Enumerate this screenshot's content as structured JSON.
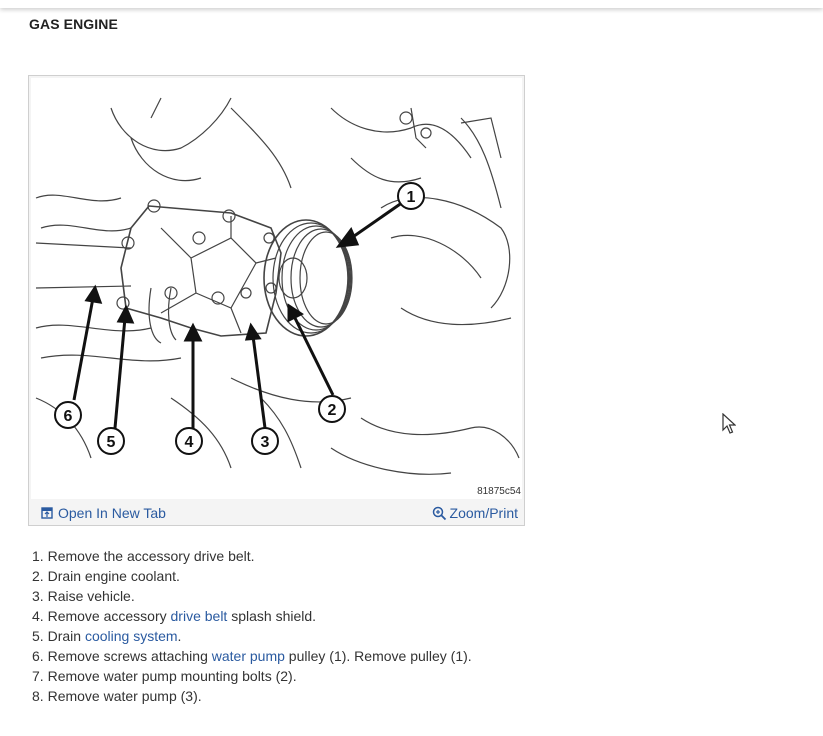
{
  "page": {
    "heading": "GAS ENGINE"
  },
  "figure": {
    "image_id": "81875c54",
    "callouts": [
      "1",
      "2",
      "3",
      "4",
      "5",
      "6"
    ],
    "open_tab_label": "Open In New Tab",
    "zoom_print_label": "Zoom/Print"
  },
  "steps": [
    {
      "num": "1.",
      "pre": "Remove the accessory drive belt.",
      "link": "",
      "post": ""
    },
    {
      "num": "2.",
      "pre": "Drain engine coolant.",
      "link": "",
      "post": ""
    },
    {
      "num": "3.",
      "pre": "Raise vehicle.",
      "link": "",
      "post": ""
    },
    {
      "num": "4.",
      "pre": "Remove accessory ",
      "link": "drive belt",
      "post": " splash shield."
    },
    {
      "num": "5.",
      "pre": "Drain ",
      "link": "cooling system",
      "post": "."
    },
    {
      "num": "6.",
      "pre": "Remove screws attaching ",
      "link": "water pump",
      "post": " pulley (1). Remove pulley (1)."
    },
    {
      "num": "7.",
      "pre": "Remove water pump mounting bolts (2).",
      "link": "",
      "post": ""
    },
    {
      "num": "8.",
      "pre": "Remove water pump (3).",
      "link": "",
      "post": ""
    }
  ],
  "colors": {
    "link": "#2a5aa0",
    "text": "#333333"
  }
}
